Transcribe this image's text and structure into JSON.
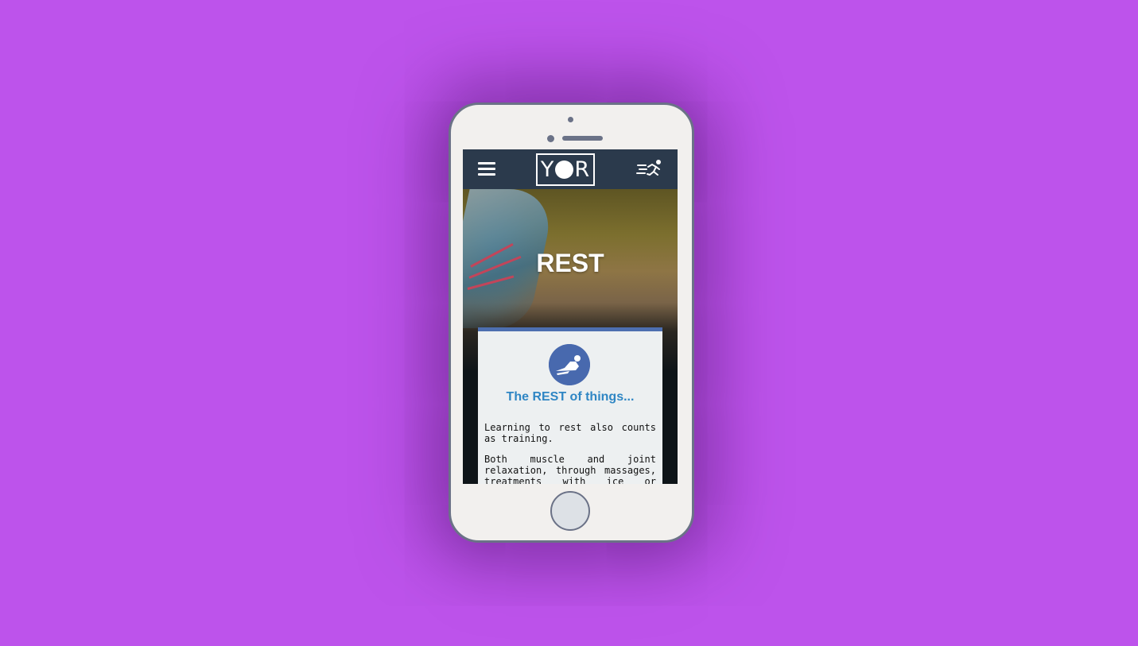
{
  "header": {
    "logo_text_left": "Y",
    "logo_text_right": "R"
  },
  "hero": {
    "title": "REST"
  },
  "card": {
    "title": "The REST of things...",
    "paragraph_1": "Learning to rest also counts as training.",
    "paragraph_2": "Both muscle and joint relaxation, through massages, treatments with ice or changes in temperature: Can"
  },
  "colors": {
    "background": "#bd53eb",
    "navbar": "#2b3a4c",
    "accent": "#4869ae",
    "title": "#2f86c4"
  },
  "icons": {
    "menu": "hamburger-icon",
    "run": "running-man-icon",
    "rest": "resting-person-icon"
  }
}
